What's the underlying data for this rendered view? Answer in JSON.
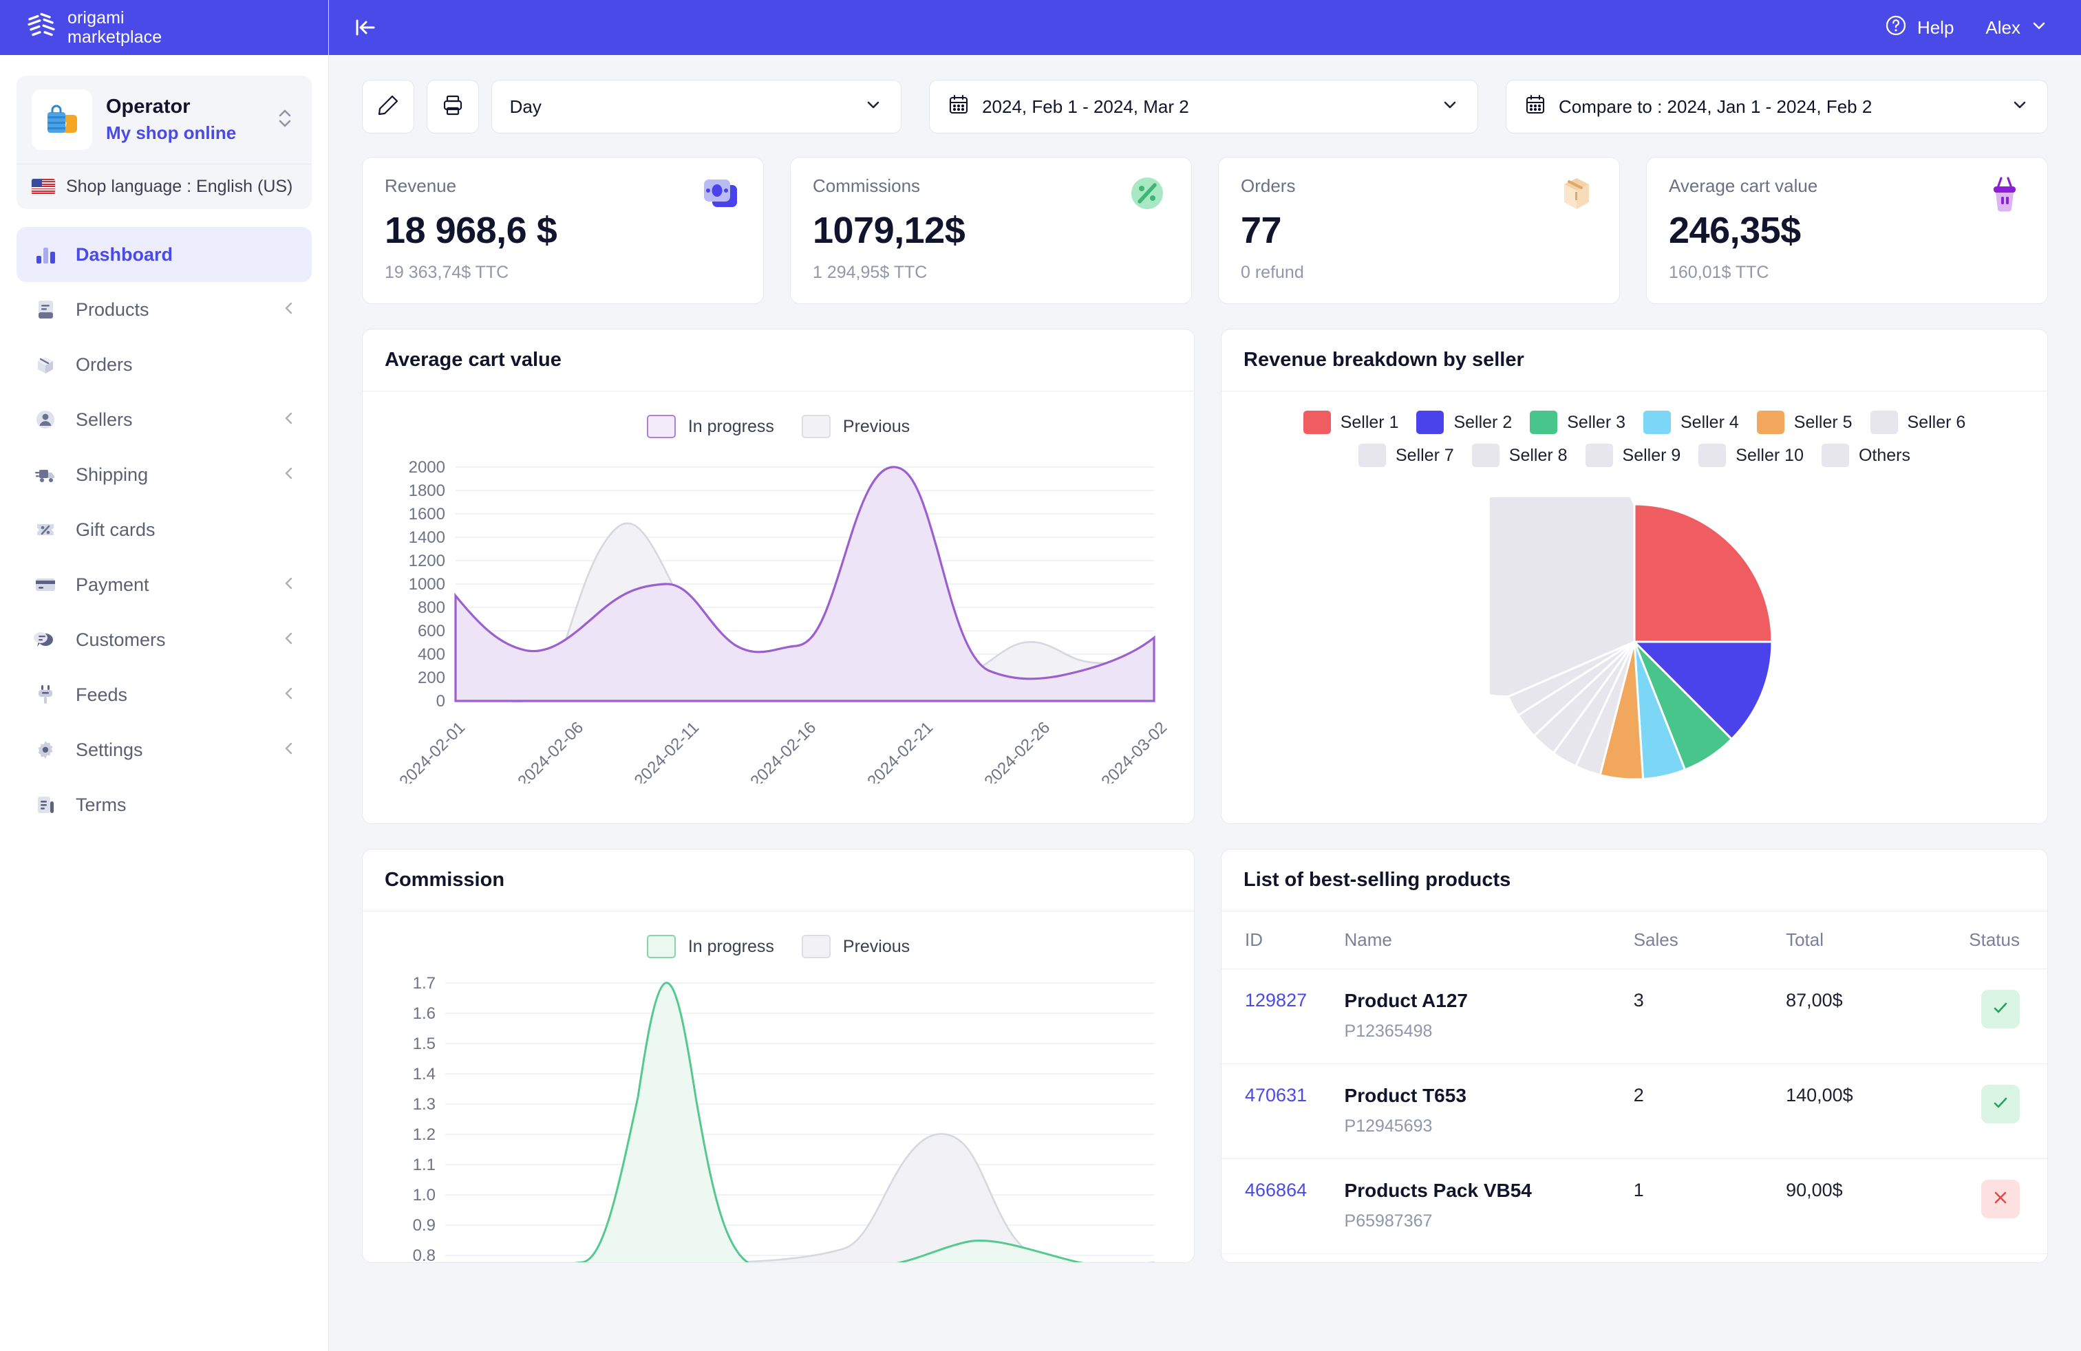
{
  "brand": {
    "line1": "origami",
    "line2": "marketplace",
    "logo_icon": "origami-logo-icon"
  },
  "topbar": {
    "collapse_icon": "collapse-sidebar-icon",
    "help_label": "Help",
    "help_icon": "question-circle-icon",
    "user_label": "Alex",
    "user_chevron_icon": "chevron-down-icon"
  },
  "sidebar": {
    "shop": {
      "title": "Operator",
      "subtitle": "My shop online",
      "avatar_icon": "shopping-bag-icon",
      "switcher_icon": "chevron-up-down-icon",
      "language_label": "Shop language : English (US)",
      "flag_icon": "us-flag-icon"
    },
    "items": [
      {
        "label": "Dashboard",
        "icon": "bar-chart-icon",
        "active": true,
        "expandable": false
      },
      {
        "label": "Products",
        "icon": "book-icon",
        "active": false,
        "expandable": true
      },
      {
        "label": "Orders",
        "icon": "box-icon",
        "active": false,
        "expandable": false
      },
      {
        "label": "Sellers",
        "icon": "user-circle-icon",
        "active": false,
        "expandable": true
      },
      {
        "label": "Shipping",
        "icon": "truck-icon",
        "active": false,
        "expandable": true
      },
      {
        "label": "Gift cards",
        "icon": "percent-tag-icon",
        "active": false,
        "expandable": false
      },
      {
        "label": "Payment",
        "icon": "credit-card-icon",
        "active": false,
        "expandable": true
      },
      {
        "label": "Customers",
        "icon": "chat-bubble-icon",
        "active": false,
        "expandable": true
      },
      {
        "label": "Feeds",
        "icon": "plug-icon",
        "active": false,
        "expandable": true
      },
      {
        "label": "Settings",
        "icon": "gear-icon",
        "active": false,
        "expandable": true
      },
      {
        "label": "Terms",
        "icon": "document-icon",
        "active": false,
        "expandable": false
      }
    ]
  },
  "toolbar": {
    "edit_icon": "pencil-icon",
    "print_icon": "printer-icon",
    "granularity": {
      "value": "Day",
      "chevron_icon": "chevron-down-icon"
    },
    "date_range": {
      "value": "2024, Feb 1 - 2024, Mar 2",
      "calendar_icon": "calendar-icon",
      "chevron_icon": "chevron-down-icon"
    },
    "compare_range": {
      "value": "Compare to : 2024, Jan 1 - 2024, Feb 2",
      "calendar_icon": "calendar-icon",
      "chevron_icon": "chevron-down-icon"
    }
  },
  "kpis": [
    {
      "label": "Revenue",
      "value": "18 968,6 $",
      "sub": "19 363,74$ TTC",
      "icon": "money-stack-icon",
      "color": "#4a4ae8"
    },
    {
      "label": "Commissions",
      "value": "1079,12$",
      "sub": "1 294,95$ TTC",
      "icon": "percent-circle-icon",
      "color": "#3fc07a"
    },
    {
      "label": "Orders",
      "value": "77",
      "sub": "0 refund",
      "icon": "package-icon",
      "color": "#f2c08a"
    },
    {
      "label": "Average cart value",
      "value": "246,35$",
      "sub": "160,01$ TTC",
      "icon": "shopping-basket-icon",
      "color": "#8b1ed6"
    }
  ],
  "panels": {
    "avg_cart": {
      "title": "Average cart value"
    },
    "revenue_breakdown": {
      "title": "Revenue breakdown by seller"
    },
    "commission": {
      "title": "Commission"
    },
    "best_selling": {
      "title": "List of best-selling products"
    }
  },
  "legend": {
    "in_progress": "In progress",
    "previous": "Previous"
  },
  "colors": {
    "brand": "#4a4ae8",
    "purple_line": "#9b5fd0",
    "purple_fill": "#efe7f7",
    "green_line": "#55c98d",
    "green_fill": "#eaf8f0",
    "grey_line": "#c9ccd6",
    "grey_fill": "#f0f0f4"
  },
  "chart_data": [
    {
      "id": "average-cart-value-chart",
      "type": "area",
      "title": "Average cart value",
      "xlabel": "",
      "ylabel": "",
      "ylim": [
        0,
        2000
      ],
      "yticks": [
        0,
        200,
        400,
        600,
        800,
        1000,
        1200,
        1400,
        1600,
        1800,
        2000
      ],
      "grid": true,
      "legend": [
        "In progress",
        "Previous"
      ],
      "legend_position": "top-center",
      "xticks": [
        "2024-02-01",
        "2024-02-06",
        "2024-02-11",
        "2024-02-16",
        "2024-02-21",
        "2024-02-26",
        "2024-03-02"
      ],
      "x": [
        "2024-02-01",
        "2024-02-03",
        "2024-02-06",
        "2024-02-09",
        "2024-02-11",
        "2024-02-13",
        "2024-02-16",
        "2024-02-18",
        "2024-02-21",
        "2024-02-23",
        "2024-02-26",
        "2024-02-28",
        "2024-03-02"
      ],
      "series": [
        {
          "name": "In progress",
          "color": "#9b5fd0",
          "values": [
            900,
            600,
            550,
            820,
            990,
            940,
            560,
            470,
            2000,
            1050,
            330,
            310,
            580
          ]
        },
        {
          "name": "Previous",
          "color": "#c9ccd6",
          "values": [
            480,
            200,
            250,
            1000,
            1420,
            1180,
            350,
            230,
            430,
            660,
            400,
            510,
            470
          ]
        }
      ]
    },
    {
      "id": "revenue-breakdown-pie",
      "type": "pie",
      "title": "Revenue breakdown by seller",
      "labels": [
        "Seller 1",
        "Seller 2",
        "Seller 3",
        "Seller 4",
        "Seller 5",
        "Seller 6",
        "Seller 7",
        "Seller 8",
        "Seller 9",
        "Seller 10",
        "Others"
      ],
      "colors": [
        "#ef5d60",
        "#4a42ea",
        "#48c58a",
        "#7bd7f5",
        "#f2a85c",
        "#e6e6ec",
        "#e6e6ec",
        "#e6e6ec",
        "#e6e6ec",
        "#e6e6ec",
        "#e6e6ec"
      ],
      "values": [
        25.0,
        12.5,
        6.5,
        5.0,
        5.0,
        3.0,
        3.0,
        3.0,
        3.0,
        2.5,
        31.5
      ],
      "legend_position": "top"
    },
    {
      "id": "commission-chart",
      "type": "area",
      "title": "Commission",
      "xlabel": "",
      "ylabel": "",
      "ylim": [
        0.8,
        1.7
      ],
      "yticks": [
        0.8,
        0.9,
        1.0,
        1.1,
        1.2,
        1.3,
        1.4,
        1.5,
        1.6,
        1.7
      ],
      "grid": true,
      "legend": [
        "In progress",
        "Previous"
      ],
      "legend_position": "top-center",
      "x": [
        "2024-02-01",
        "2024-02-06",
        "2024-02-11",
        "2024-02-16",
        "2024-02-21",
        "2024-02-26",
        "2024-03-02"
      ],
      "series": [
        {
          "name": "In progress",
          "color": "#55c98d",
          "values": [
            0.78,
            0.79,
            1.7,
            0.8,
            0.85,
            0.79,
            0.8
          ]
        },
        {
          "name": "Previous",
          "color": "#c9ccd6",
          "values": [
            0.78,
            0.78,
            0.79,
            0.8,
            1.18,
            0.8,
            0.82
          ]
        }
      ]
    }
  ],
  "table": {
    "columns": [
      "ID",
      "Name",
      "Sales",
      "Total",
      "Status"
    ],
    "rows": [
      {
        "id": "129827",
        "name": "Product A127",
        "ref": "P12365498",
        "sales": "3",
        "total": "87,00$",
        "status": "ok",
        "status_icon": "check-icon"
      },
      {
        "id": "470631",
        "name": "Product T653",
        "ref": "P12945693",
        "sales": "2",
        "total": "140,00$",
        "status": "ok",
        "status_icon": "check-icon"
      },
      {
        "id": "466864",
        "name": "Products Pack VB54",
        "ref": "P65987367",
        "sales": "1",
        "total": "90,00$",
        "status": "no",
        "status_icon": "close-icon"
      }
    ]
  }
}
